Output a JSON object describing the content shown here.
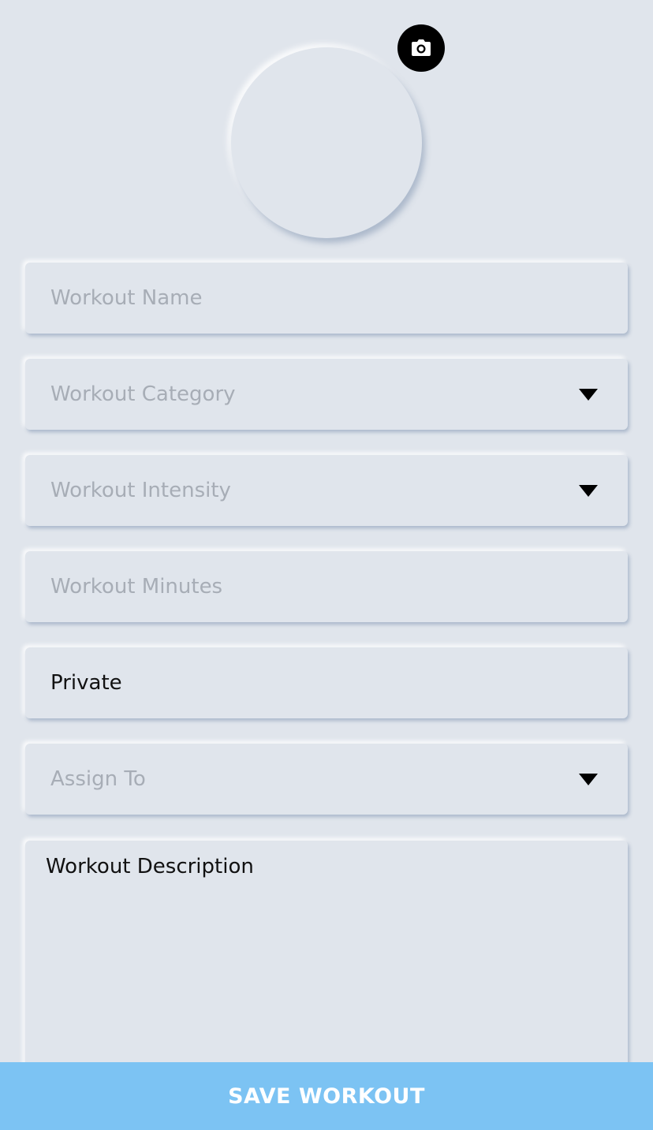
{
  "profile": {
    "photo_icon": "camera-icon"
  },
  "form": {
    "workout_name": {
      "placeholder": "Workout Name",
      "value": ""
    },
    "workout_category": {
      "placeholder": "Workout Category",
      "icon": "chevron-down-icon"
    },
    "workout_intensity": {
      "placeholder": "Workout Intensity",
      "icon": "chevron-down-icon"
    },
    "workout_minutes": {
      "placeholder": "Workout Minutes",
      "value": ""
    },
    "visibility": {
      "value": "Private"
    },
    "assign_to": {
      "placeholder": "Assign To",
      "icon": "chevron-down-icon"
    },
    "workout_description": {
      "value": "Workout Description"
    }
  },
  "actions": {
    "save_label": "SAVE WORKOUT"
  },
  "colors": {
    "background": "#e0e5ec",
    "placeholder_text": "#a7adb6",
    "save_button": "#7cc3f3",
    "camera_button": "#000000"
  }
}
